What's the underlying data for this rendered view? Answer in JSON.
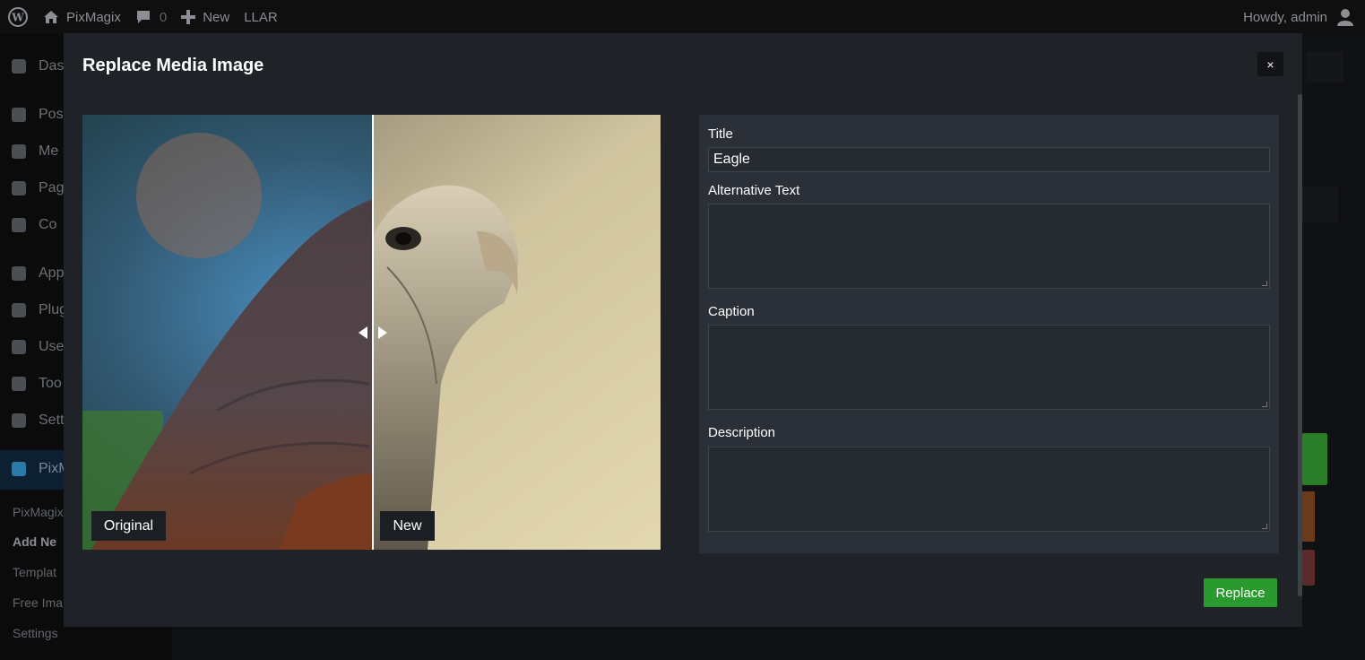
{
  "adminbar": {
    "site_name": "PixMagix",
    "comments_count": "0",
    "new_label": "New",
    "llar_label": "LLAR",
    "howdy": "Howdy, admin"
  },
  "sidebar": {
    "items": [
      {
        "label": "Das",
        "icon": "dashboard-icon"
      },
      {
        "label": "Pos",
        "icon": "pin-icon"
      },
      {
        "label": "Me",
        "icon": "media-icon"
      },
      {
        "label": "Pag",
        "icon": "pages-icon"
      },
      {
        "label": "Co",
        "icon": "comments-icon"
      },
      {
        "label": "App",
        "icon": "appearance-icon"
      },
      {
        "label": "Plug",
        "icon": "plugins-icon"
      },
      {
        "label": "Use",
        "icon": "users-icon"
      },
      {
        "label": "Too",
        "icon": "tools-icon"
      },
      {
        "label": "Sett",
        "icon": "settings-icon"
      },
      {
        "label": "PixM",
        "icon": "pixmagix-icon"
      }
    ],
    "submenu": [
      "PixMagix",
      "Add Ne",
      "Templat",
      "Free Ima",
      "Settings"
    ]
  },
  "modal": {
    "title": "Replace Media Image",
    "close_label": "×",
    "original_tag": "Original",
    "new_tag": "New",
    "form": {
      "title_label": "Title",
      "title_value": "Eagle",
      "alt_label": "Alternative Text",
      "alt_value": "",
      "caption_label": "Caption",
      "caption_value": "",
      "description_label": "Description",
      "description_value": ""
    },
    "replace_label": "Replace"
  },
  "colors": {
    "accent_green": "#2a9a2f",
    "modal_bg": "#1f2328",
    "panel_bg": "#2b3038"
  }
}
